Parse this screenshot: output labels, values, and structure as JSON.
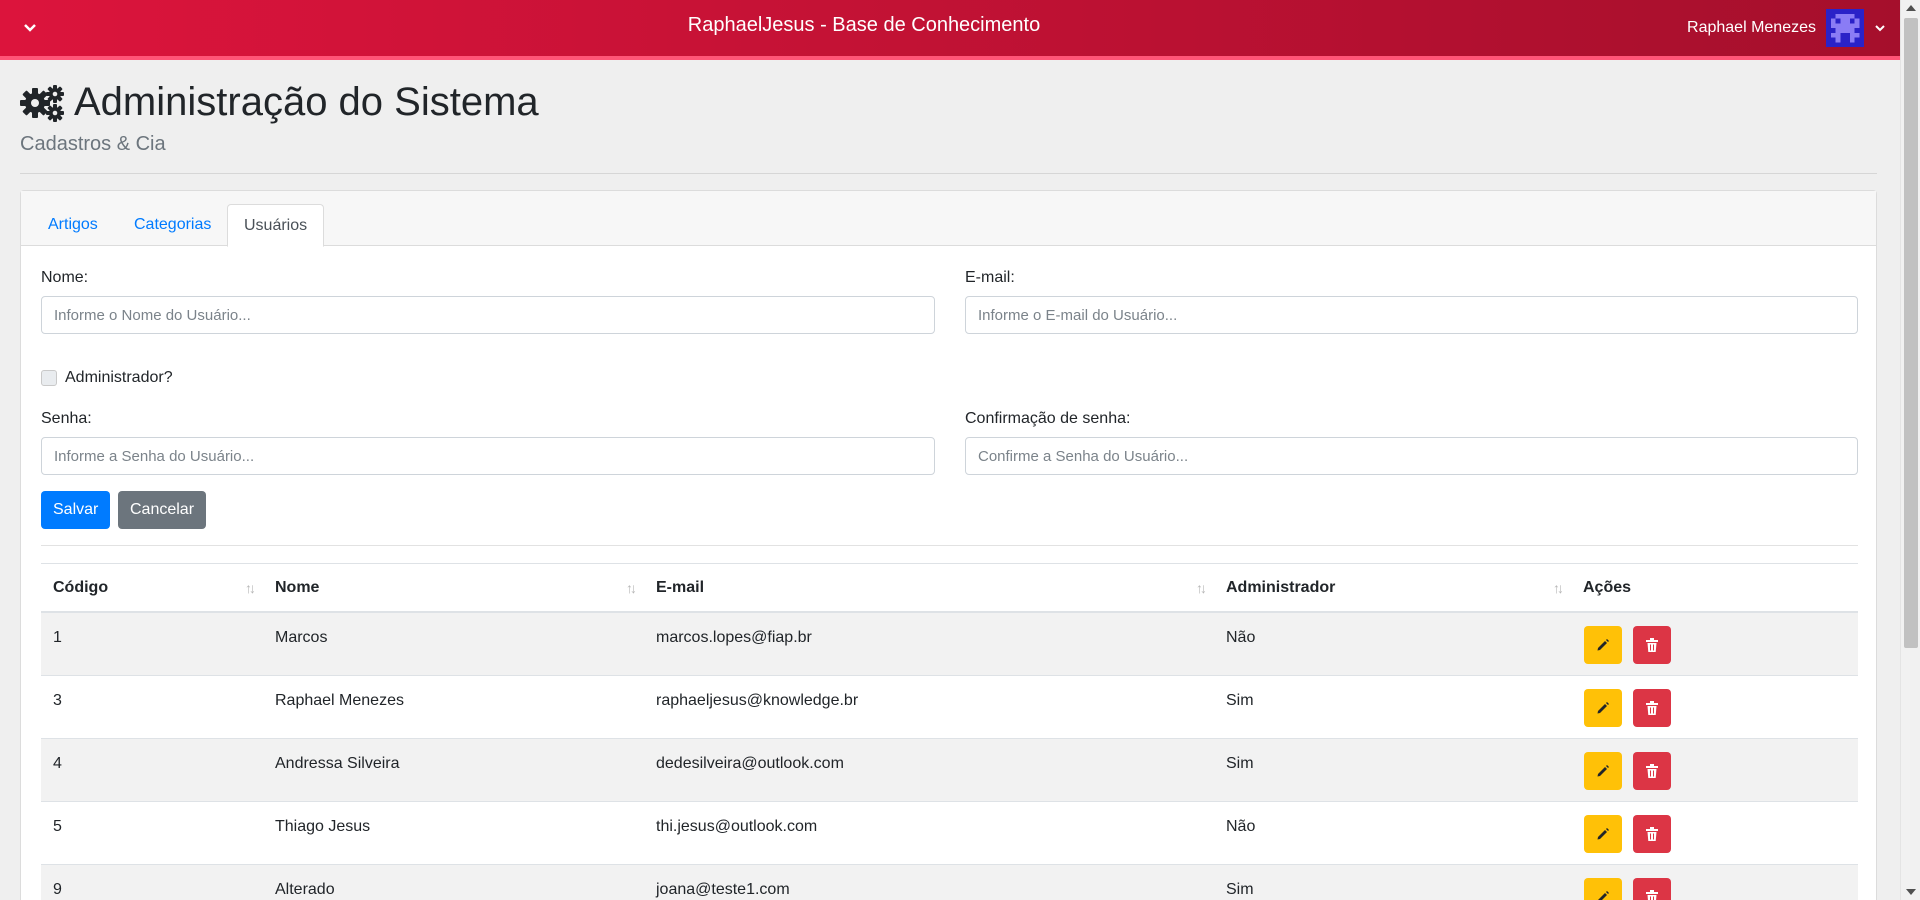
{
  "header": {
    "title": "RaphaelJesus - Base de Conhecimento",
    "user_name": "Raphael Menezes",
    "menu_toggle_icon": "chevron-down-icon",
    "user_dropdown_icon": "chevron-down-icon",
    "colors": {
      "gradient_start": "#dc143c",
      "gradient_end": "#a50f2c"
    }
  },
  "page": {
    "icon": "gears-icon",
    "title": "Administração do Sistema",
    "subtitle": "Cadastros & Cia"
  },
  "tabs": [
    {
      "label": "Artigos",
      "active": false
    },
    {
      "label": "Categorias",
      "active": false
    },
    {
      "label": "Usuários",
      "active": true
    }
  ],
  "form": {
    "name_label": "Nome:",
    "name_placeholder": "Informe o Nome do Usuário...",
    "email_label": "E-mail:",
    "email_placeholder": "Informe o E-mail do Usuário...",
    "admin_label": "Administrador?",
    "admin_checked": false,
    "password_label": "Senha:",
    "password_placeholder": "Informe a Senha do Usuário...",
    "confirm_label": "Confirmação de senha:",
    "confirm_placeholder": "Confirme a Senha do Usuário...",
    "save_label": "Salvar",
    "cancel_label": "Cancelar"
  },
  "table": {
    "headers": [
      "Código",
      "Nome",
      "E-mail",
      "Administrador",
      "Ações"
    ],
    "rows": [
      {
        "code": "1",
        "name": "Marcos",
        "email": "marcos.lopes@fiap.br",
        "admin": "Não"
      },
      {
        "code": "3",
        "name": "Raphael Menezes",
        "email": "raphaeljesus@knowledge.br",
        "admin": "Sim"
      },
      {
        "code": "4",
        "name": "Andressa Silveira",
        "email": "dedesilveira@outlook.com",
        "admin": "Sim"
      },
      {
        "code": "5",
        "name": "Thiago Jesus",
        "email": "thi.jesus@outlook.com",
        "admin": "Não"
      },
      {
        "code": "9",
        "name": "Alterado",
        "email": "joana@teste1.com",
        "admin": "Sim"
      }
    ],
    "edit_icon": "pencil-icon",
    "delete_icon": "trash-icon"
  }
}
